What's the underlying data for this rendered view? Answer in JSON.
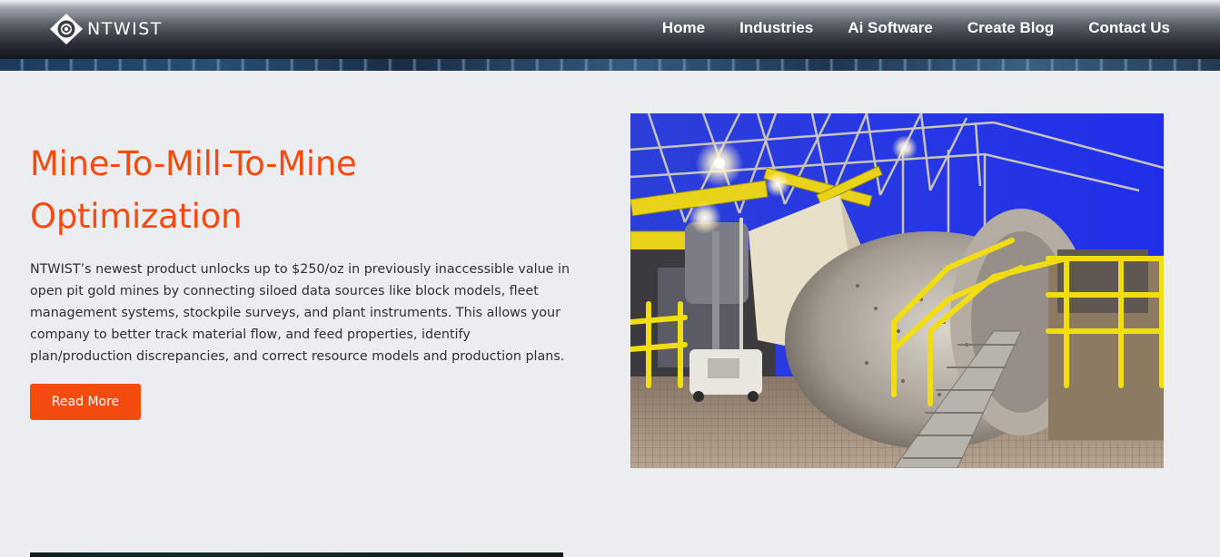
{
  "header": {
    "logo_text": "NTWIST",
    "nav": [
      {
        "label": "Home"
      },
      {
        "label": "Industries"
      },
      {
        "label": "Ai Software"
      },
      {
        "label": "Create Blog"
      },
      {
        "label": "Contact Us"
      }
    ]
  },
  "hero": {
    "title_line1": "Mine-To-Mill-To-Mine",
    "title_line2": "Optimization",
    "description": "NTWIST’s newest product unlocks up to $250/oz in previously inaccessible value in open pit gold mines by connecting siloed data sources like block models, fleet management systems, stockpile surveys, and plant instruments. This allows your company to better track material flow, and feed properties, identify plan/production discrepancies, and correct resource models and production plans.",
    "button_label": "Read More",
    "image_subject": "grinding-mill-plant-photo"
  },
  "colors": {
    "accent": "#f54b0f",
    "background": "#ecedf1",
    "text": "#2d2f33",
    "nav_text": "#ffffff"
  }
}
